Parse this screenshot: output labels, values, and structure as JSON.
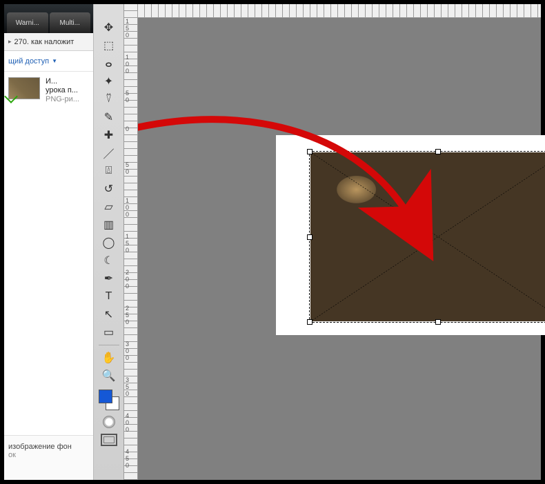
{
  "tabs": {
    "a": "Warni...",
    "b": "Multi..."
  },
  "nav": {
    "arrow": "▸",
    "label": "270. как наложит"
  },
  "shared": {
    "label": "щий доступ",
    "caret": "▼"
  },
  "file": {
    "line1": "И...",
    "line2": "урока п...",
    "type": "PNG-ри..."
  },
  "footer": {
    "line1": "изображение фон",
    "line2": "ок"
  },
  "tools": {
    "move": "✥",
    "marquee": "⬚",
    "lasso": "ⴰ",
    "wand": "✦",
    "crop": "⍢",
    "eyedrop": "✎",
    "heal": "✚",
    "brush": "／",
    "stamp": "⍍",
    "history": "↺",
    "eraser": "▱",
    "grad": "▥",
    "blur": "◯",
    "dodge": "☾",
    "pen": "✒",
    "type": "T",
    "path": "↖",
    "shape": "▭",
    "hand": "✋",
    "zoom": "🔍"
  },
  "ruler": {
    "v": [
      "1",
      "5",
      "0",
      "1",
      "0",
      "0",
      "5",
      "0",
      "0",
      "5",
      "0",
      "1",
      "0",
      "0",
      "1",
      "5",
      "0",
      "2",
      "0",
      "0",
      "2",
      "5",
      "0",
      "3",
      "0",
      "0",
      "3",
      "5",
      "0",
      "4",
      "0",
      "0",
      "4",
      "5",
      "0"
    ]
  },
  "colors": {
    "fg": "#1558d6",
    "bg": "#ffffff",
    "arrow": "#d40808"
  }
}
